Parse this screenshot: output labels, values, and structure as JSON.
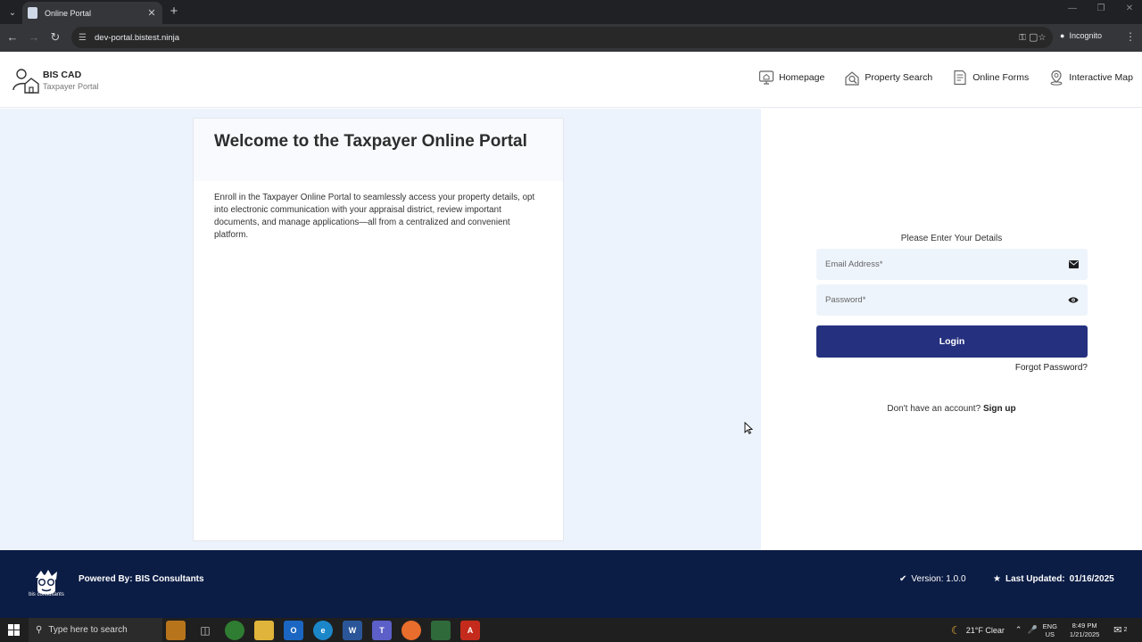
{
  "browser": {
    "tab_title": "Online Portal",
    "url": "dev-portal.bistest.ninja",
    "incognito_label": "Incognito"
  },
  "header": {
    "brand_title": "BIS CAD",
    "brand_subtitle": "Taxpayer Portal",
    "nav": [
      {
        "label": "Homepage",
        "icon": "monitor-icon"
      },
      {
        "label": "Property Search",
        "icon": "property-search-icon"
      },
      {
        "label": "Online Forms",
        "icon": "document-icon"
      },
      {
        "label": "Interactive Map",
        "icon": "map-pin-icon"
      }
    ]
  },
  "welcome": {
    "title": "Welcome to the Taxpayer Online Portal",
    "body": "Enroll in the Taxpayer Online Portal to seamlessly access your property details, opt into electronic communication with your appraisal district, review important documents, and manage applications—all from a centralized and convenient platform."
  },
  "login": {
    "heading": "Please Enter Your Details",
    "email_placeholder": "Email Address*",
    "email_value": "",
    "password_placeholder": "Password*",
    "password_value": "",
    "login_label": "Login",
    "forgot_label": "Forgot Password?",
    "signup_prompt": "Don't have an account?",
    "signup_label": "Sign up"
  },
  "footer": {
    "logo_text": "bis consultants",
    "powered_by": "Powered By: BIS Consultants",
    "version": "Version: 1.0.0",
    "last_updated_label": "Last Updated:",
    "last_updated_value": "01/16/2025"
  },
  "taskbar": {
    "search_placeholder": "Type here to search",
    "weather": "21°F  Clear",
    "lang_top": "ENG",
    "lang_bottom": "US",
    "time": "8:49 PM",
    "date": "1/21/2025",
    "notification_count": "2"
  },
  "colors": {
    "primary": "#25317f",
    "footer_bg": "#0b1c45",
    "left_panel_bg": "#edf3fc",
    "input_bg": "#eef4fc"
  }
}
